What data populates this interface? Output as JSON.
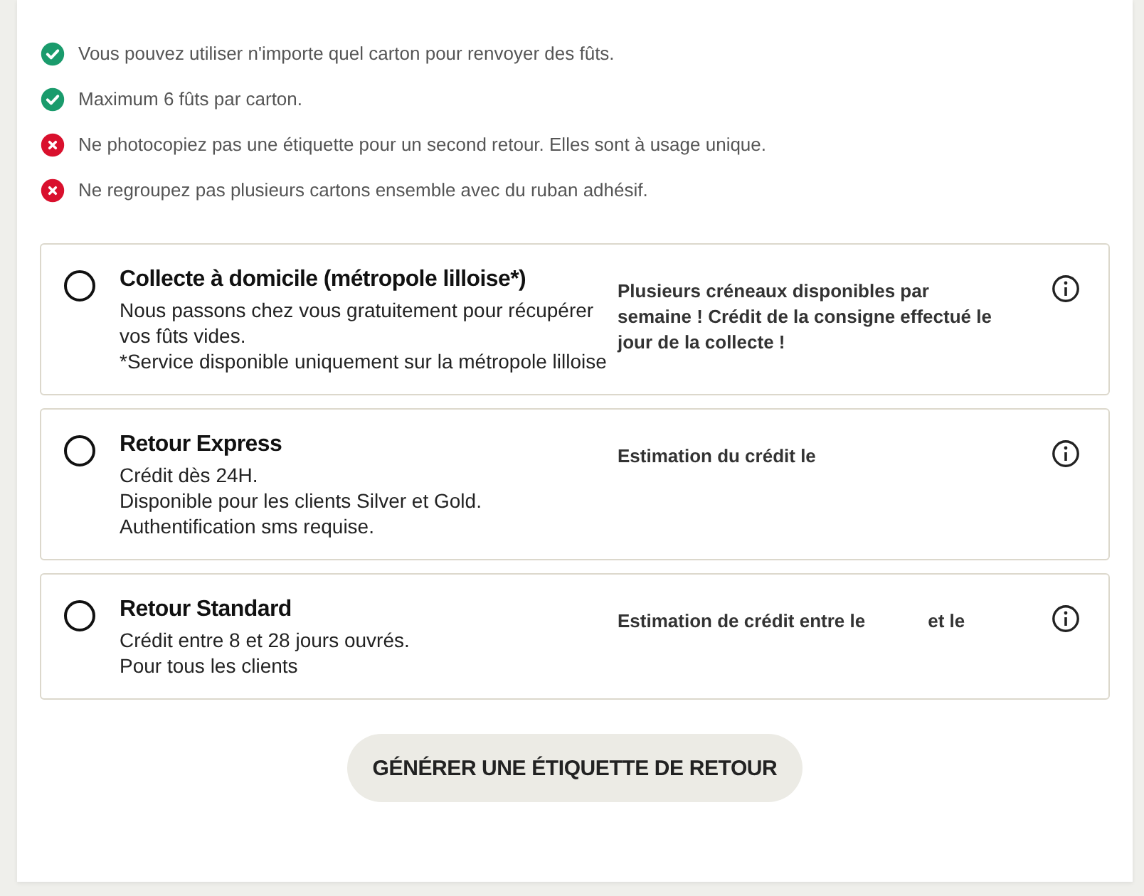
{
  "rules": [
    {
      "kind": "ok",
      "text": "Vous pouvez utiliser n'importe quel carton pour renvoyer des fûts."
    },
    {
      "kind": "ok",
      "text": "Maximum 6 fûts par carton."
    },
    {
      "kind": "no",
      "text": "Ne photocopiez pas une étiquette pour un second retour. Elles sont à usage unique."
    },
    {
      "kind": "no",
      "text": "Ne regroupez pas plusieurs cartons ensemble avec du ruban adhésif."
    }
  ],
  "options": [
    {
      "title": "Collecte à domicile (métropole lilloise*)",
      "selected": false,
      "lines": [
        "Nous passons chez vous gratuitement pour récupérer vos fûts vides.",
        "*Service disponible uniquement sur la métropole lilloise"
      ],
      "info": [
        "Plusieurs créneaux disponibles par semaine ! Crédit de la consigne effectué le jour de la collecte !"
      ]
    },
    {
      "title": "Retour Express",
      "selected": false,
      "lines": [
        "Crédit dès 24H.",
        "Disponible pour les clients Silver et Gold.",
        "Authentification sms requise."
      ],
      "info": [
        "Estimation du crédit le"
      ]
    },
    {
      "title": "Retour Standard",
      "selected": false,
      "lines": [
        "Crédit entre 8 et 28 jours ouvrés.",
        "Pour tous les clients"
      ],
      "info": [
        "Estimation de crédit entre le",
        "et le"
      ]
    }
  ],
  "button": "GÉNÉRER UNE ÉTIQUETTE DE RETOUR"
}
